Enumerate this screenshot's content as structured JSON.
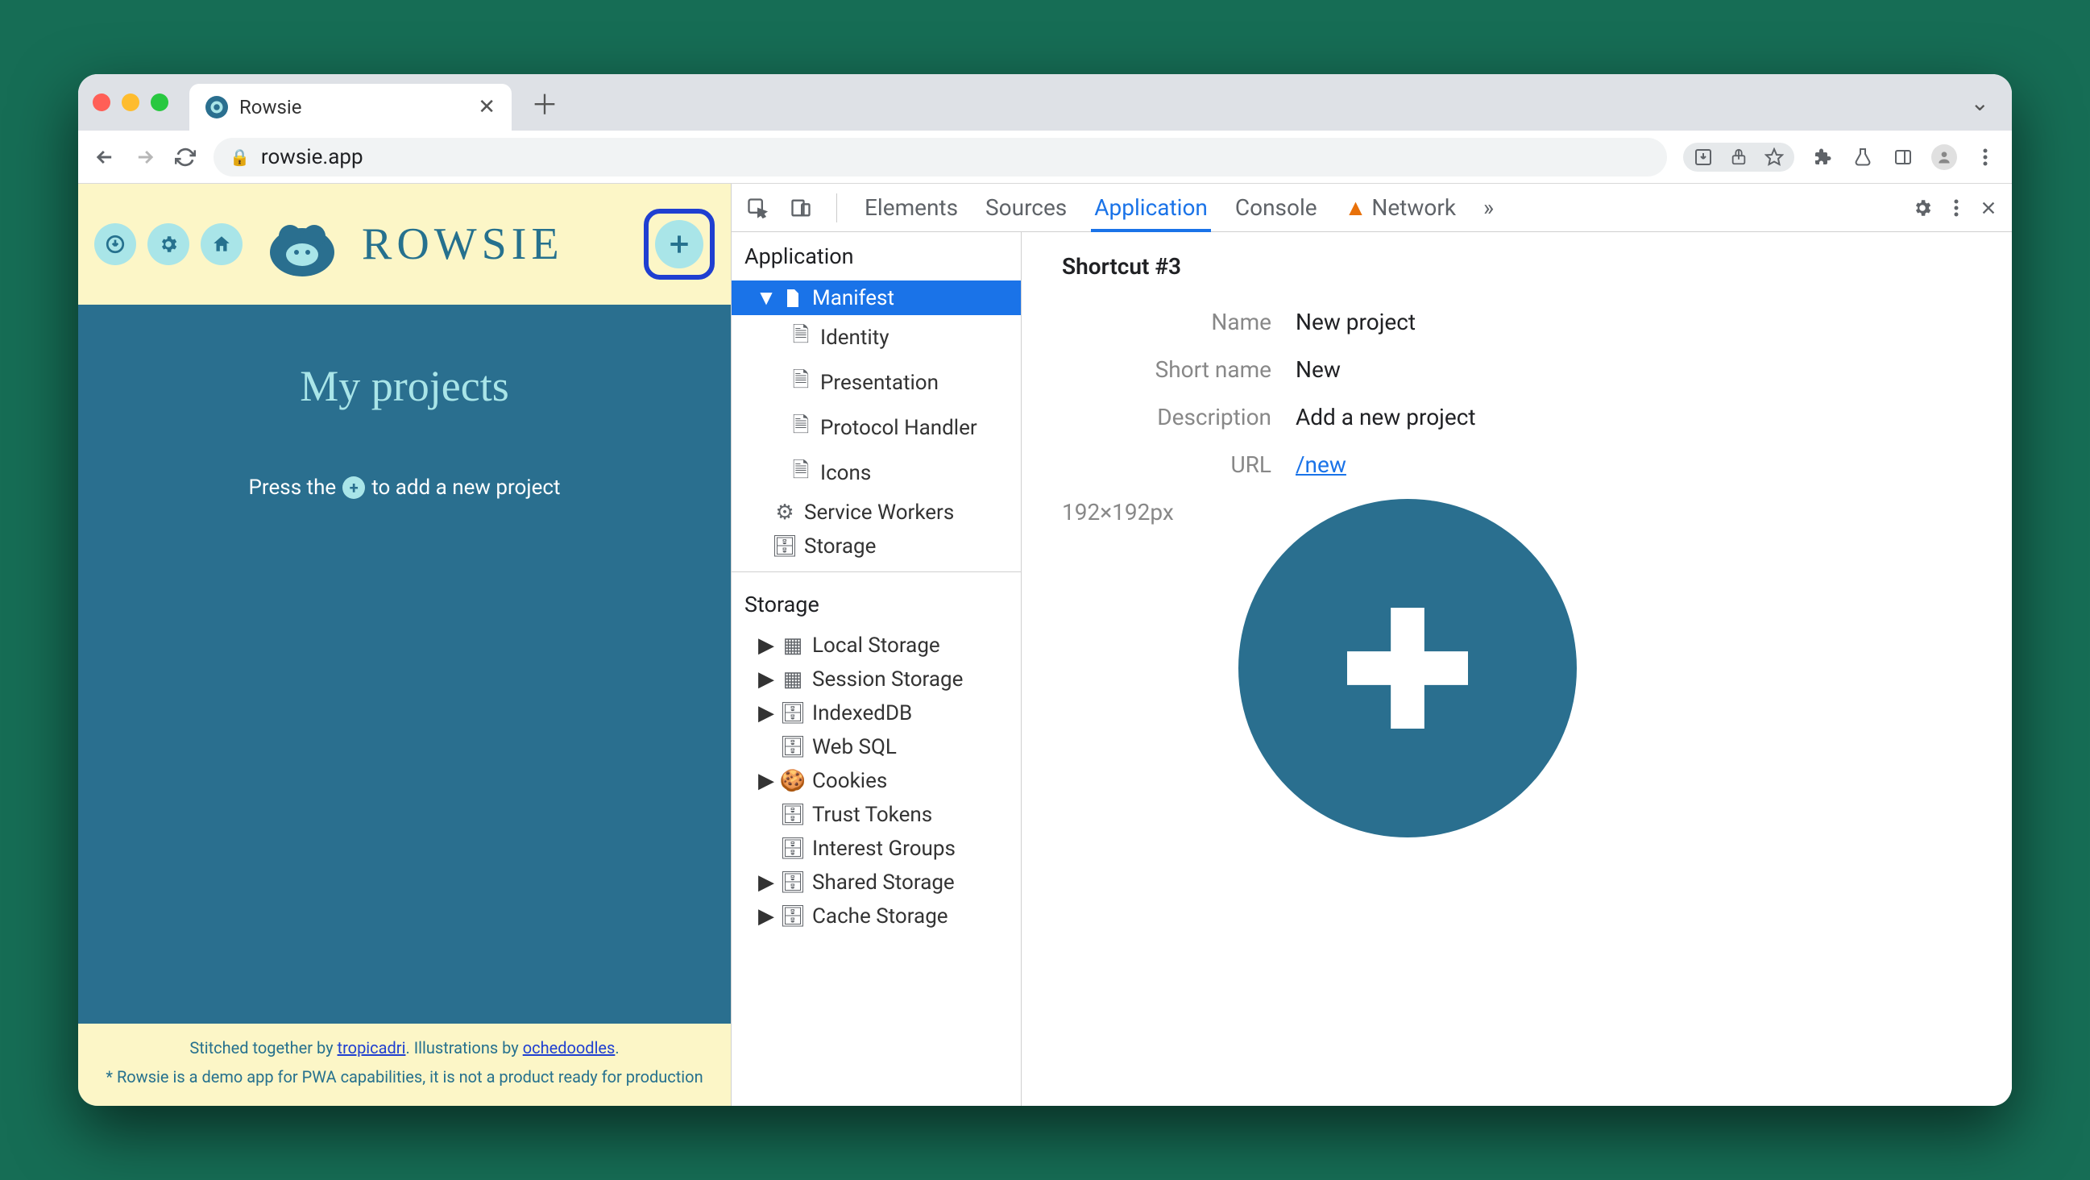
{
  "browser": {
    "tab_title": "Rowsie",
    "url": "rowsie.app"
  },
  "rowsie": {
    "wordmark": "ROWSIE",
    "main_title": "My projects",
    "hint_prefix": "Press the",
    "hint_suffix": "to add a new project",
    "footer_prefix": "Stitched together by ",
    "footer_link1": "tropicadri",
    "footer_mid": ". Illustrations by ",
    "footer_link2": "ochedoodles",
    "footer_suffix": ".",
    "footer_disclaimer": "* Rowsie is a demo app for PWA capabilities, it is not a product ready for production"
  },
  "devtools": {
    "tabs": {
      "elements": "Elements",
      "sources": "Sources",
      "application": "Application",
      "console": "Console",
      "network": "Network"
    },
    "overflow": "»",
    "sidebar": {
      "app_heading": "Application",
      "manifest": "Manifest",
      "identity": "Identity",
      "presentation": "Presentation",
      "protocol": "Protocol Handler",
      "icons": "Icons",
      "service_workers": "Service Workers",
      "storage_app": "Storage",
      "storage_heading": "Storage",
      "local_storage": "Local Storage",
      "session_storage": "Session Storage",
      "indexeddb": "IndexedDB",
      "websql": "Web SQL",
      "cookies": "Cookies",
      "trust_tokens": "Trust Tokens",
      "interest_groups": "Interest Groups",
      "shared_storage": "Shared Storage",
      "cache_storage": "Cache Storage"
    },
    "detail": {
      "title": "Shortcut #3",
      "name_label": "Name",
      "name_value": "New project",
      "short_label": "Short name",
      "short_value": "New",
      "desc_label": "Description",
      "desc_value": "Add a new project",
      "url_label": "URL",
      "url_value": "/new",
      "icon_dim": "192×192px"
    }
  }
}
